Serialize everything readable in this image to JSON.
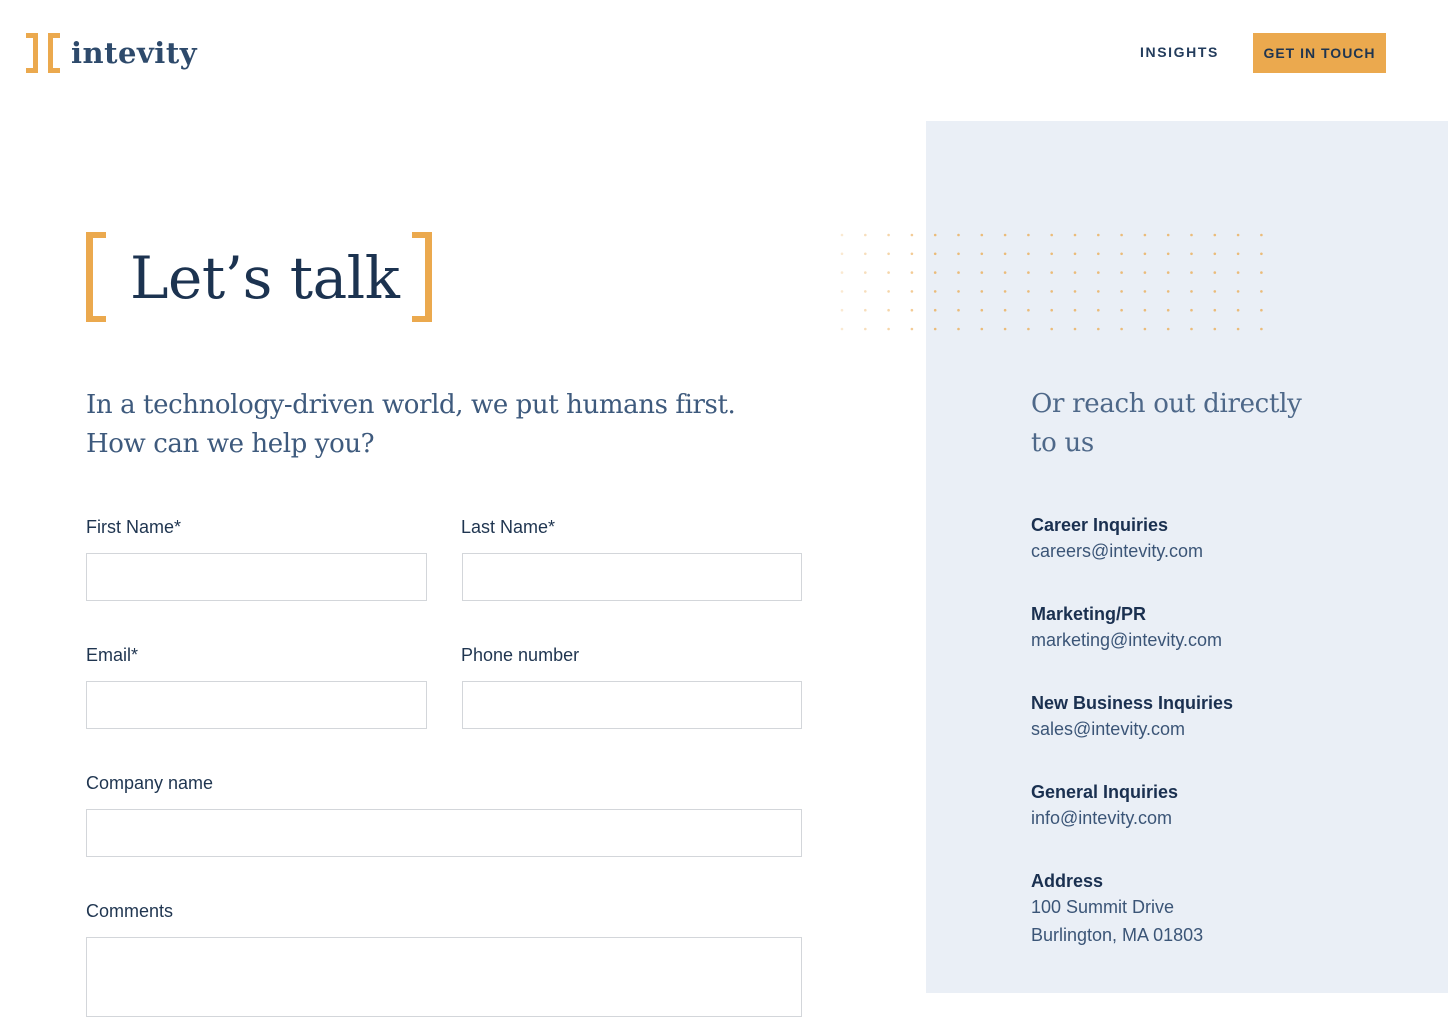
{
  "header": {
    "logo_text": "intevity",
    "nav_insights": "INSIGHTS",
    "cta_label": "GET IN TOUCH"
  },
  "hero": {
    "title": "Let’s talk",
    "intro_line1": "In a technology-driven world, we put humans first.",
    "intro_line2": "How can we help you?"
  },
  "form": {
    "first_name_label": "First Name*",
    "last_name_label": "Last Name*",
    "email_label": "Email*",
    "phone_label": "Phone number",
    "company_label": "Company name",
    "comments_label": "Comments"
  },
  "sidebar": {
    "heading_line1": "Or reach out directly",
    "heading_line2": "to us",
    "contacts": [
      {
        "heading": "Career Inquiries",
        "value": "careers@intevity.com"
      },
      {
        "heading": "Marketing/PR",
        "value": "marketing@intevity.com"
      },
      {
        "heading": "New Business Inquiries",
        "value": "sales@intevity.com"
      },
      {
        "heading": "General Inquiries",
        "value": "info@intevity.com"
      }
    ],
    "address": {
      "heading": "Address",
      "line1": "100 Summit Drive",
      "line2": "Burlington, MA 01803"
    }
  },
  "colors": {
    "accent": "#eba94e",
    "navy": "#1c3350",
    "panel": "#eaeff6"
  },
  "icons": {
    "logo": "bracket-logo-icon",
    "title_brackets": "orange-bracket-icon",
    "pattern": "dot-pattern"
  }
}
